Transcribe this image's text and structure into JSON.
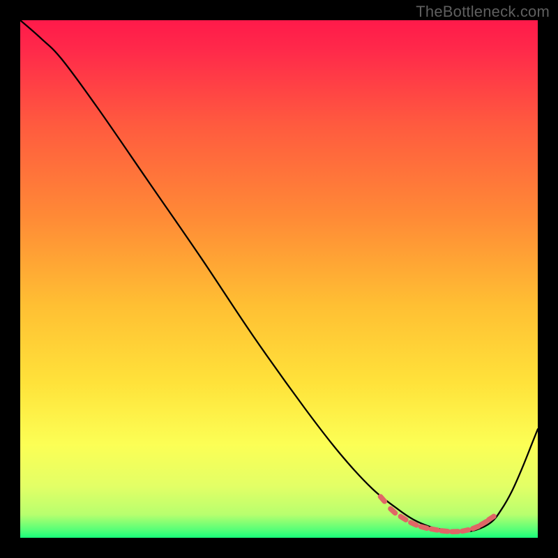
{
  "watermark": "TheBottleneck.com",
  "colors": {
    "page_bg": "#000000",
    "curve_stroke": "#000000",
    "marker_fill": "#e06666",
    "gradient_top": "#ff1a4a",
    "gradient_mid1": "#ff7a3a",
    "gradient_mid2": "#ffd93b",
    "gradient_mid3": "#f4ff66",
    "gradient_bottom": "#19ff7a"
  },
  "chart_data": {
    "type": "line",
    "title": "",
    "xlabel": "",
    "ylabel": "",
    "xlim": [
      0,
      100
    ],
    "ylim": [
      0,
      100
    ],
    "series": [
      {
        "name": "curve",
        "x": [
          0,
          4,
          8,
          15,
          25,
          35,
          45,
          55,
          62,
          68,
          73,
          76,
          79,
          82,
          85,
          88,
          91,
          93,
          95,
          97,
          99,
          100
        ],
        "y": [
          100,
          96.5,
          92.5,
          83,
          68.5,
          54,
          39,
          25,
          16,
          9.5,
          5.5,
          3.5,
          2.2,
          1.5,
          1.2,
          1.5,
          3,
          5.5,
          9,
          13.5,
          18.5,
          21
        ]
      }
    ],
    "markers": {
      "name": "dots",
      "x": [
        70,
        72,
        74,
        76,
        78,
        80,
        82,
        84,
        86,
        88,
        89.5,
        91
      ],
      "y": [
        7.5,
        5.2,
        3.8,
        2.7,
        2.0,
        1.6,
        1.3,
        1.2,
        1.4,
        2.0,
        2.8,
        3.8
      ]
    }
  }
}
